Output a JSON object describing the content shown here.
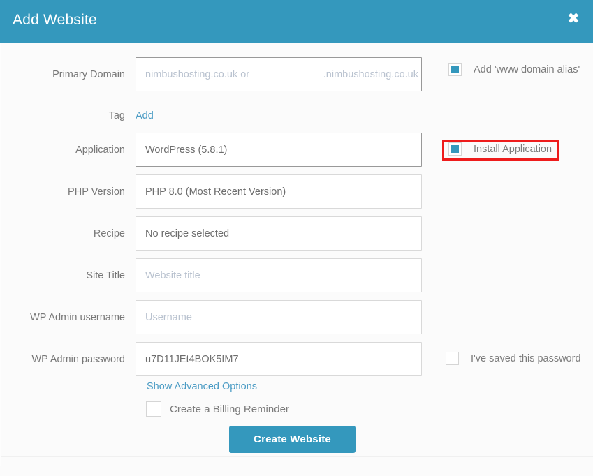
{
  "header": {
    "title": "Add Website",
    "close_label": "✖"
  },
  "form": {
    "rows": [
      {
        "label": "Primary Domain",
        "type": "domain",
        "placeholder_left": "nimbushosting.co.uk or",
        "placeholder_right": ".nimbushosting.co.uk",
        "value": ""
      },
      {
        "label": "Tag",
        "type": "link",
        "link_label": "Add"
      },
      {
        "label": "Application",
        "type": "text",
        "value": "WordPress (5.8.1)",
        "placeholder": ""
      },
      {
        "label": "PHP Version",
        "type": "text",
        "value": "PHP 8.0 (Most Recent Version)",
        "placeholder": ""
      },
      {
        "label": "Recipe",
        "type": "text",
        "value": "No recipe selected",
        "placeholder": ""
      },
      {
        "label": "Site Title",
        "type": "text",
        "value": "",
        "placeholder": "Website title"
      },
      {
        "label": "WP Admin username",
        "type": "text",
        "value": "",
        "placeholder": "Username"
      },
      {
        "label": "WP Admin password",
        "type": "text",
        "value": "u7D11JEt4BOK5fM7",
        "placeholder": ""
      }
    ]
  },
  "options": {
    "www_alias": {
      "label": "Add 'www domain alias'",
      "checked": true
    },
    "install_application": {
      "label": "Install Application",
      "checked": true,
      "highlighted": true
    },
    "saved_password": {
      "label": "I've saved this password",
      "checked": false
    },
    "billing_reminder": {
      "label": "Create a Billing Reminder",
      "checked": false
    }
  },
  "links": {
    "advanced_options": "Show Advanced Options"
  },
  "actions": {
    "submit": "Create Website"
  },
  "colors": {
    "accent": "#3498bd",
    "link": "#4a9bc4",
    "annotation": "#ee1c1c",
    "placeholder": "#b9c2cf"
  }
}
